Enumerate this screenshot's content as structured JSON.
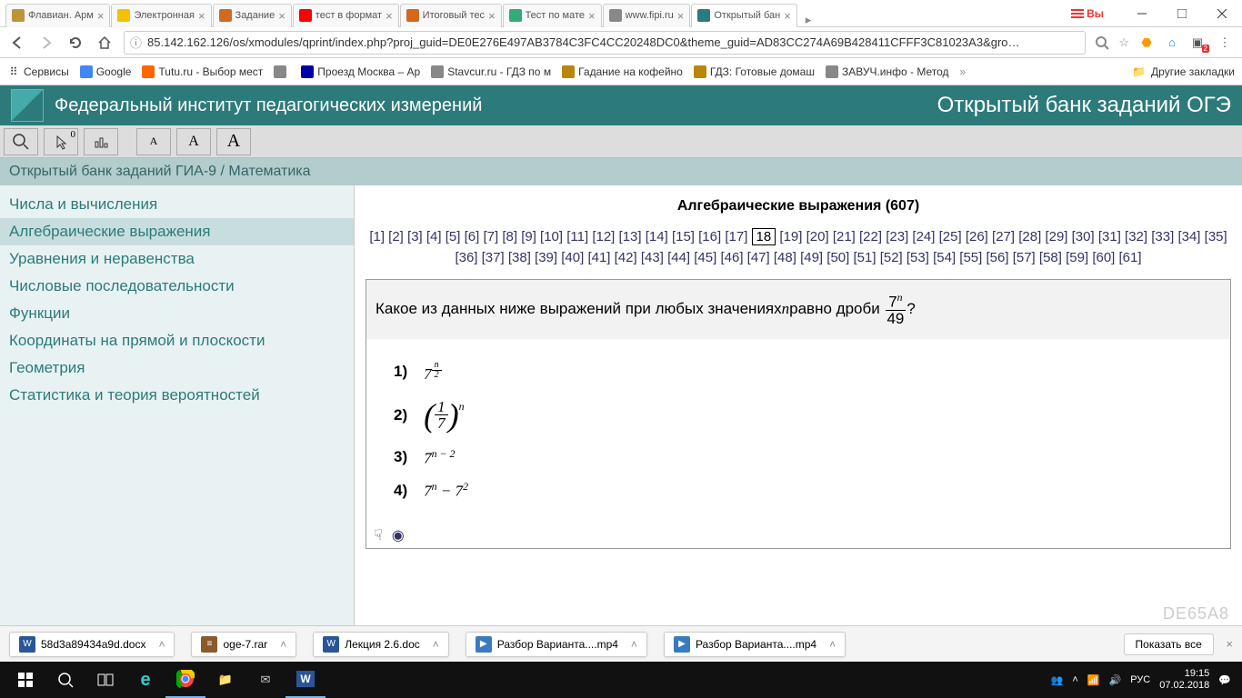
{
  "tabs": [
    {
      "title": "Флавиан. Арм",
      "icon": "#c0933a"
    },
    {
      "title": "Электронная",
      "icon": "#f2c200"
    },
    {
      "title": "Задание",
      "icon": "#d2691e"
    },
    {
      "title": "тест в формат",
      "icon": "#ff0000"
    },
    {
      "title": "Итоговый тес",
      "icon": "#d2691e"
    },
    {
      "title": "Тест по мате",
      "icon": "#3a7"
    },
    {
      "title": "www.fipi.ru",
      "icon": "#888"
    },
    {
      "title": "Открытый бан",
      "icon": "#2d7a7a",
      "active": true
    }
  ],
  "yandex_label": "Вы",
  "url": "85.142.162.126/os/xmodules/qprint/index.php?proj_guid=DE0E276E497AB3784C3FC4CC20248DC0&theme_guid=AD83CC274A69B428411CFFF3C81023A3&gro…",
  "ext_badge": "2",
  "bookmarks": {
    "apps": "Сервисы",
    "items": [
      {
        "label": "Google",
        "color": "#4285f4"
      },
      {
        "label": "Tutu.ru - Выбор мест",
        "color": "#ff6600"
      },
      {
        "label": "",
        "color": "#888"
      },
      {
        "label": "Проезд Москва – Ар",
        "color": "#00a"
      },
      {
        "label": "Stavcur.ru - ГДЗ по м",
        "color": "#888"
      },
      {
        "label": "Гадание на кофейно",
        "color": "#b8860b"
      },
      {
        "label": "ГДЗ: Готовые домаш",
        "color": "#b8860b"
      },
      {
        "label": "ЗАВУЧ.инфо - Метод",
        "color": "#888"
      }
    ],
    "other": "Другие закладки"
  },
  "fipi": {
    "title": "Федеральный институт педагогических измерений",
    "right": "Открытый банк заданий ОГЭ"
  },
  "toolbar_count": "0",
  "breadcrumb": "Открытый банк заданий ГИА-9 / Математика",
  "sidebar": [
    "Числа и вычисления",
    "Алгебраические выражения",
    "Уравнения и неравенства",
    "Числовые последовательности",
    "Функции",
    "Координаты на прямой и плоскости",
    "Геометрия",
    "Статистика и теория вероятностей"
  ],
  "sidebar_selected": 1,
  "content": {
    "title": "Алгебраические выражения (607)",
    "pages_total": 61,
    "current_page": 18,
    "question_prefix": "Какое из данных ниже выражений при любых значениях ",
    "question_var": "n",
    "question_mid": " равно дроби ",
    "question_suffix": " ?",
    "frac_num": "7",
    "frac_num_exp": "n",
    "frac_den": "49",
    "options": [
      "1)",
      "2)",
      "3)",
      "4)"
    ],
    "code": "DE65A8"
  },
  "downloads": [
    {
      "name": "58d3a89434a9d.docx",
      "type": "word"
    },
    {
      "name": "oge-7.rar",
      "type": "rar"
    },
    {
      "name": "Лекция 2.6.doc",
      "type": "word"
    },
    {
      "name": "Разбор Варианта....mp4",
      "type": "mp4"
    },
    {
      "name": "Разбор Варианта....mp4",
      "type": "mp4"
    }
  ],
  "show_all": "Показать все",
  "taskbar": {
    "lang": "РУС",
    "time": "19:15",
    "date": "07.02.2018"
  }
}
